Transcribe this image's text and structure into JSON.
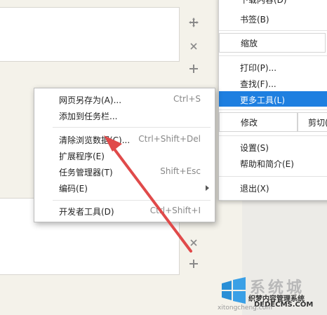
{
  "main_menu": {
    "downloads": "下载内容(D)",
    "bookmarks": "书签(B)",
    "zoom": "缩放",
    "print": "打印(P)...",
    "find": "查找(F)...",
    "more_tools": "更多工具(L)",
    "edit": "修改",
    "cut": "剪切(",
    "settings": "设置(S)",
    "help": "帮助和简介(E)",
    "exit": "退出(X)"
  },
  "submenu": {
    "items": [
      {
        "label": "网页另存为(A)...",
        "shortcut": "Ctrl+S"
      },
      {
        "label": "添加到任务栏...",
        "shortcut": ""
      },
      {
        "label": "清除浏览数据(C)...",
        "shortcut": "Ctrl+Shift+Del"
      },
      {
        "label": "扩展程序(E)",
        "shortcut": ""
      },
      {
        "label": "任务管理器(T)",
        "shortcut": "Shift+Esc"
      },
      {
        "label": "编码(E)",
        "shortcut": ""
      },
      {
        "label": "开发者工具(D)",
        "shortcut": "Ctrl+Shift+I"
      }
    ]
  },
  "watermark": {
    "brand": "系统城",
    "site1": "织梦内容管理系统",
    "site2": "DEDECMS.COM",
    "site3": "xitongcheng.com"
  },
  "colors": {
    "highlight": "#1e7fe0",
    "arrow": "#e04a4a"
  }
}
